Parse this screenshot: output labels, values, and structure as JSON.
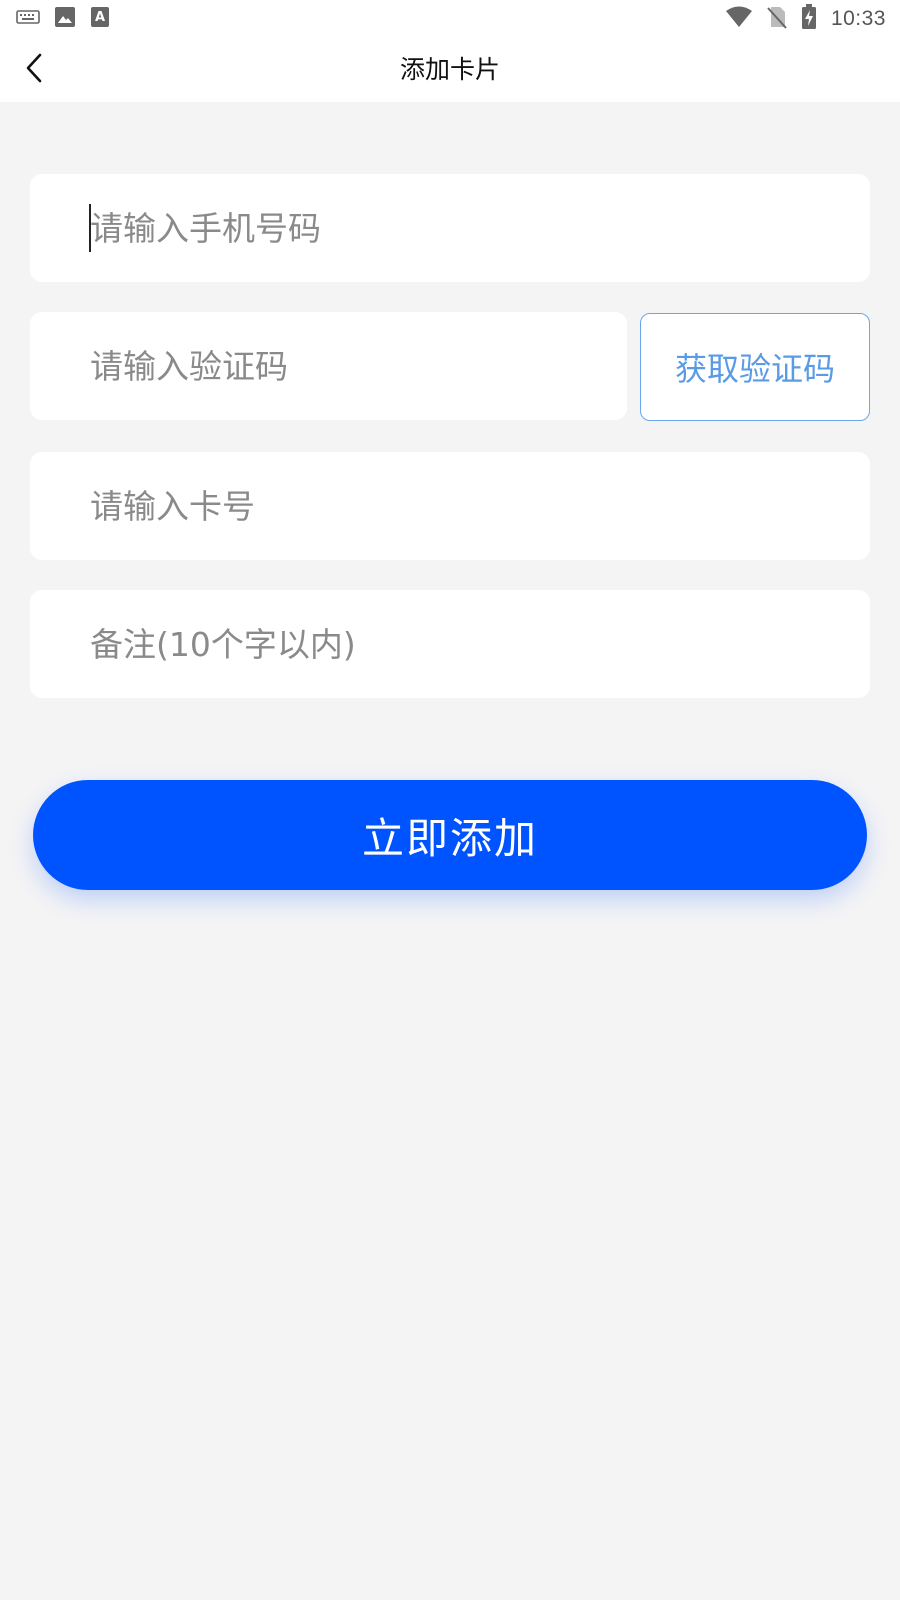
{
  "status_bar": {
    "time": "10:33",
    "left_icons": [
      "keyboard-icon",
      "image-icon",
      "font-icon"
    ],
    "right_icons": [
      "wifi-icon",
      "no-sim-icon",
      "battery-charging-icon"
    ]
  },
  "navbar": {
    "title": "添加卡片",
    "back_icon": "chevron-left-icon"
  },
  "form": {
    "phone_placeholder": "请输入手机号码",
    "code_placeholder": "请输入验证码",
    "get_code_label": "获取验证码",
    "card_placeholder": "请输入卡号",
    "remark_placeholder": "备注(10个字以内)",
    "submit_label": "立即添加"
  },
  "colors": {
    "primary": "#0054ff",
    "code_button_text": "#5a9be6",
    "code_button_border": "#6aa6ee",
    "background": "#f4f4f5"
  }
}
